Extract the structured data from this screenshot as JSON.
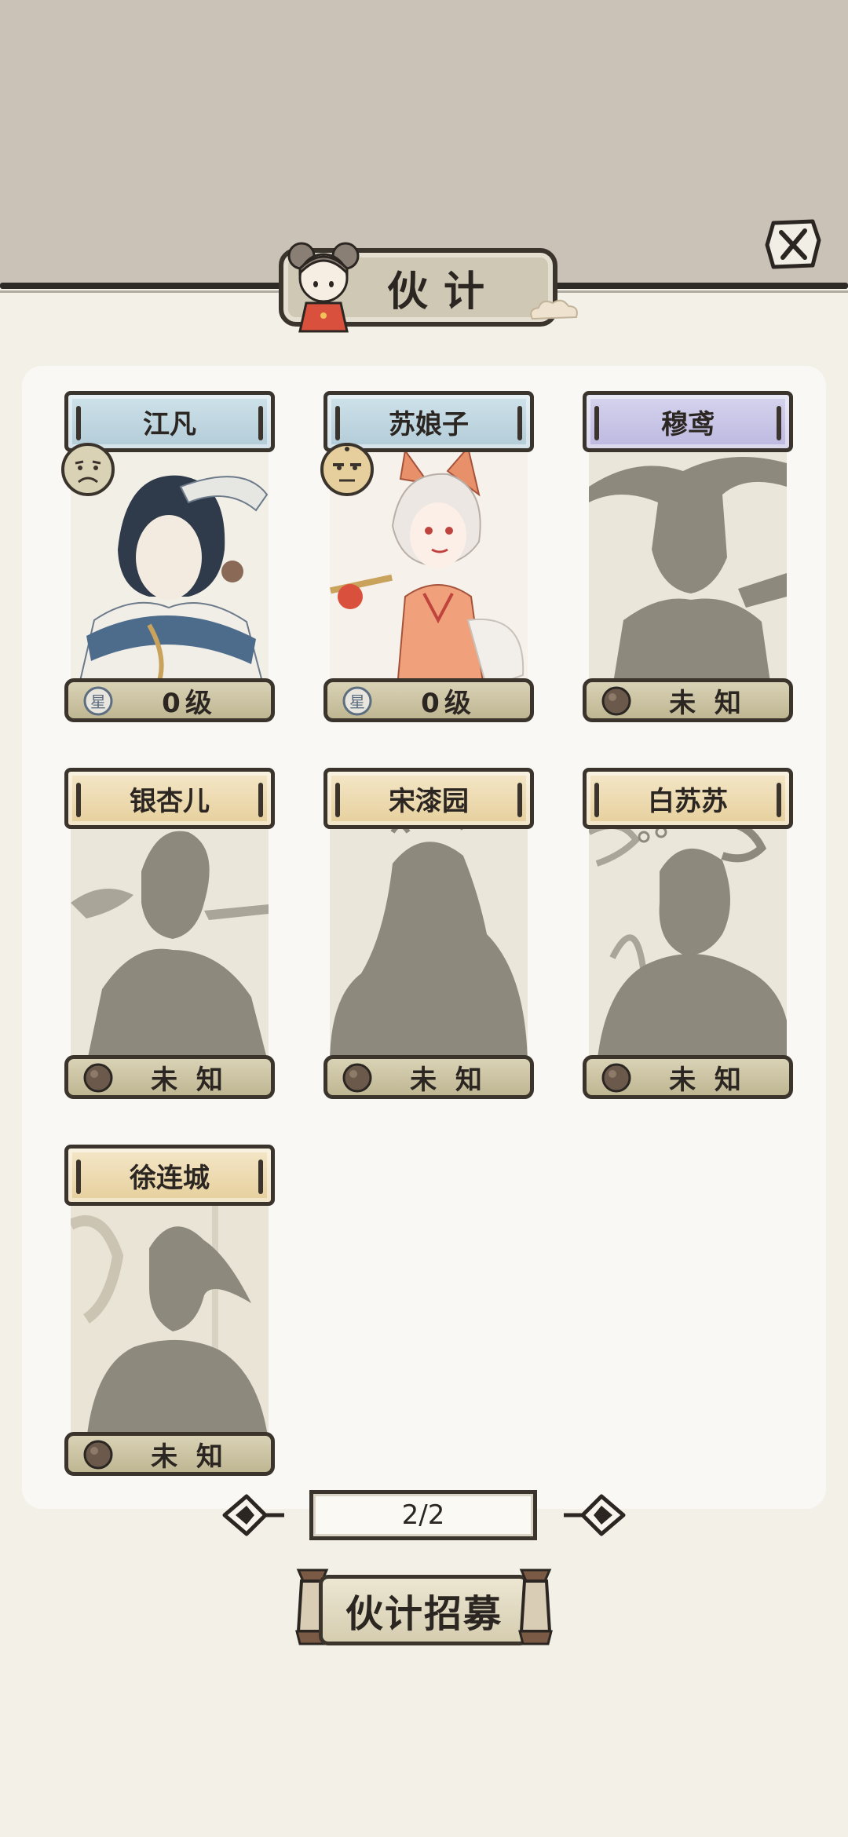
{
  "header": {
    "title": "伙计"
  },
  "companions": [
    {
      "name": "江凡",
      "status": "0级",
      "plate": "blue",
      "unlocked": true,
      "mood": "sad-face-icon"
    },
    {
      "name": "苏娘子",
      "status": "0级",
      "plate": "blue",
      "unlocked": true,
      "mood": "neutral-face-icon"
    },
    {
      "name": "穆鸢",
      "status": "未 知",
      "plate": "purple",
      "unlocked": false
    },
    {
      "name": "银杏儿",
      "status": "未 知",
      "plate": "gold",
      "unlocked": false
    },
    {
      "name": "宋漆园",
      "status": "未 知",
      "plate": "gold",
      "unlocked": false
    },
    {
      "name": "白苏苏",
      "status": "未 知",
      "plate": "gold",
      "unlocked": false
    },
    {
      "name": "徐连城",
      "status": "未 知",
      "plate": "gold",
      "unlocked": false
    }
  ],
  "pager": {
    "label": "2/2"
  },
  "recruit": {
    "label": "伙计招募"
  },
  "icons": {
    "close": "close-icon",
    "star": "star-badge-icon",
    "unknown": "unknown-orb-icon",
    "prev": "prev-page-icon",
    "next": "next-page-icon"
  },
  "colors": {
    "top_band": "#cbc2b7",
    "background": "#f3f1e7",
    "panel": "#f9f8f4",
    "ink": "#3a342d",
    "plate_blue": "#c1d7e1",
    "plate_purple": "#c9c6e7",
    "plate_gold": "#eddbb2",
    "silhouette": "#8d897c"
  }
}
